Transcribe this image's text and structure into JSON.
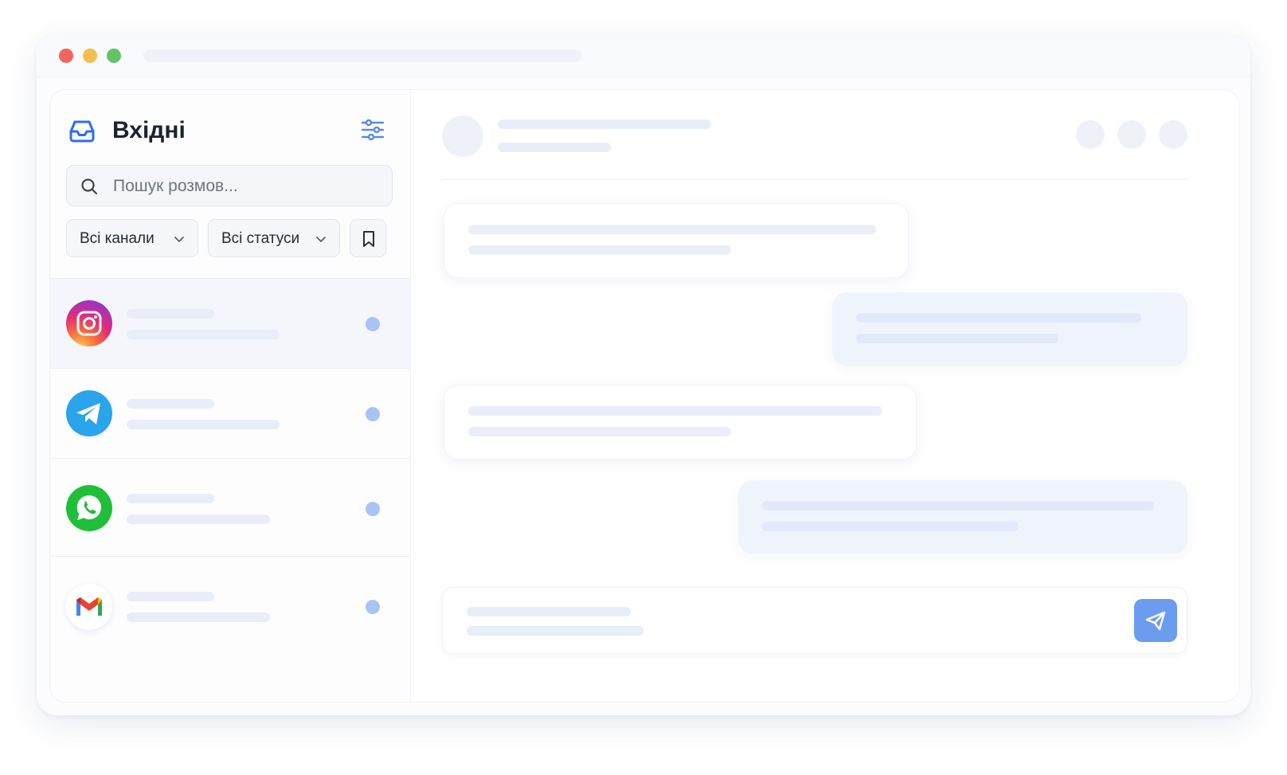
{
  "window": {
    "controls": [
      "close",
      "minimize",
      "maximize"
    ]
  },
  "sidebar": {
    "title": "Вхідні",
    "title_icon": "inbox-icon",
    "filter_icon": "sliders-icon",
    "search": {
      "placeholder": "Пошук розмов...",
      "value": ""
    },
    "channel_filter": {
      "selected": "Всі канали"
    },
    "status_filter": {
      "selected": "Всі статуси"
    },
    "bookmark_icon": "bookmark-icon",
    "conversations": [
      {
        "channel": "instagram",
        "icon": "instagram-icon",
        "active": true,
        "unread": true
      },
      {
        "channel": "telegram",
        "icon": "telegram-icon",
        "active": false,
        "unread": true
      },
      {
        "channel": "whatsapp",
        "icon": "whatsapp-icon",
        "active": false,
        "unread": true
      },
      {
        "channel": "gmail",
        "icon": "gmail-icon",
        "active": false,
        "unread": true
      }
    ]
  },
  "chat": {
    "messages": [
      {
        "direction": "incoming"
      },
      {
        "direction": "outgoing"
      },
      {
        "direction": "incoming"
      },
      {
        "direction": "outgoing"
      }
    ],
    "send_icon": "paper-plane-icon"
  },
  "colors": {
    "accent": "#2f6bf2",
    "send_button": "#6b9cf0",
    "unread_dot": "#a9c4f4",
    "skeleton": "#e8edf7"
  }
}
